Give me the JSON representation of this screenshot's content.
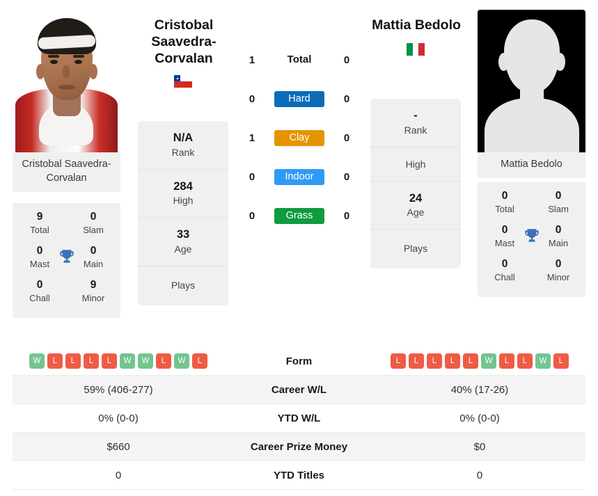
{
  "players": {
    "left": {
      "headline_name": "Cristobal Saavedra-Corvalan",
      "photo_caption": "Cristobal Saavedra-Corvalan",
      "flag": "chile-flag",
      "rank": "N/A",
      "rank_label": "Rank",
      "high": "284",
      "high_label": "High",
      "age": "33",
      "age_label": "Age",
      "plays": "",
      "plays_label": "Plays",
      "titles": {
        "total": "9",
        "total_label": "Total",
        "slam": "0",
        "slam_label": "Slam",
        "mast": "0",
        "mast_label": "Mast",
        "main": "0",
        "main_label": "Main",
        "chall": "0",
        "chall_label": "Chall",
        "minor": "9",
        "minor_label": "Minor",
        "icon": "trophy-icon"
      },
      "form": [
        "W",
        "L",
        "L",
        "L",
        "L",
        "W",
        "W",
        "L",
        "W",
        "L"
      ],
      "career_wl": "59% (406-277)",
      "ytd_wl": "0% (0-0)",
      "career_prize_money": "$660",
      "ytd_titles": "0"
    },
    "right": {
      "headline_name": "Mattia Bedolo",
      "photo_caption": "Mattia Bedolo",
      "flag": "italy-flag",
      "rank": "-",
      "rank_label": "Rank",
      "high": "",
      "high_label": "High",
      "age": "24",
      "age_label": "Age",
      "plays": "",
      "plays_label": "Plays",
      "titles": {
        "total": "0",
        "total_label": "Total",
        "slam": "0",
        "slam_label": "Slam",
        "mast": "0",
        "mast_label": "Mast",
        "main": "0",
        "main_label": "Main",
        "chall": "0",
        "chall_label": "Chall",
        "minor": "0",
        "minor_label": "Minor",
        "icon": "trophy-icon"
      },
      "form": [
        "L",
        "L",
        "L",
        "L",
        "L",
        "W",
        "L",
        "L",
        "W",
        "L"
      ],
      "career_wl": "40% (17-26)",
      "ytd_wl": "0% (0-0)",
      "career_prize_money": "$0",
      "ytd_titles": "0"
    }
  },
  "surfaces": {
    "rows": [
      {
        "label": "Total",
        "left": "1",
        "right": "0",
        "type": "text",
        "color": ""
      },
      {
        "label": "Hard",
        "left": "0",
        "right": "0",
        "type": "pill",
        "color": "#0b6cb8"
      },
      {
        "label": "Clay",
        "left": "1",
        "right": "0",
        "type": "pill",
        "color": "#e59400"
      },
      {
        "label": "Indoor",
        "left": "0",
        "right": "0",
        "type": "pill",
        "color": "#2f9bf5"
      },
      {
        "label": "Grass",
        "left": "0",
        "right": "0",
        "type": "pill",
        "color": "#0f9b40"
      }
    ]
  },
  "table": {
    "rows": [
      {
        "label": "Form",
        "key": "form",
        "shade": false
      },
      {
        "label": "Career W/L",
        "key": "career_wl",
        "shade": true
      },
      {
        "label": "YTD W/L",
        "key": "ytd_wl",
        "shade": false
      },
      {
        "label": "Career Prize Money",
        "key": "career_prize_money",
        "shade": true
      },
      {
        "label": "YTD Titles",
        "key": "ytd_titles",
        "shade": false
      }
    ]
  },
  "colors": {
    "win_badge": "#74c490",
    "loss_badge": "#ef5b45",
    "card_bg": "#f0f0f0",
    "trophy": "#3b71b8"
  }
}
